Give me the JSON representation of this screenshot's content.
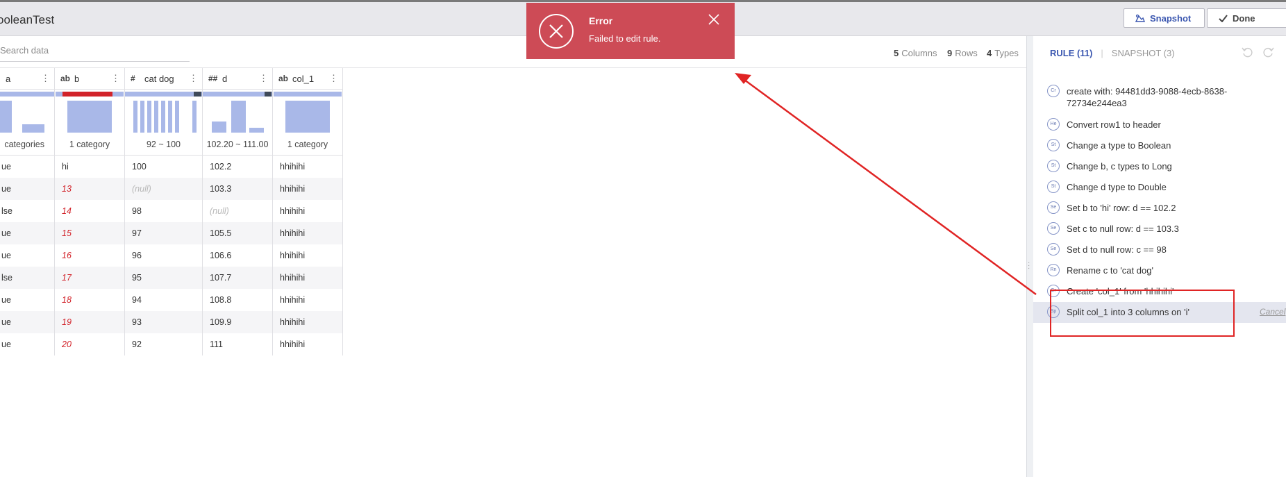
{
  "app": {
    "title": "ooleanTest",
    "snapshot_label": "Snapshot",
    "done_label": "Done"
  },
  "toast": {
    "title": "Error",
    "message": "Failed to edit rule."
  },
  "search": {
    "placeholder": "Search data"
  },
  "stats": {
    "columns_num": "5",
    "columns_label": "Columns",
    "rows_num": "9",
    "rows_label": "Rows",
    "types_num": "4",
    "types_label": "Types"
  },
  "grid": {
    "columns": [
      {
        "type": "",
        "name": "a",
        "summary": "categories"
      },
      {
        "type": "ab",
        "name": "b",
        "summary": "1 category"
      },
      {
        "type": "#",
        "name": "cat dog",
        "summary": "92 ~ 100"
      },
      {
        "type": "##",
        "name": "d",
        "summary": "102.20 ~ 111.00"
      },
      {
        "type": "ab",
        "name": "col_1",
        "summary": "1 category"
      }
    ],
    "rows": [
      [
        "ue",
        "hi",
        "100",
        "102.2",
        "hhihihi"
      ],
      [
        "ue",
        "13",
        "(null)",
        "103.3",
        "hhihihi"
      ],
      [
        "lse",
        "14",
        "98",
        "(null)",
        "hhihihi"
      ],
      [
        "ue",
        "15",
        "97",
        "105.5",
        "hhihihi"
      ],
      [
        "ue",
        "16",
        "96",
        "106.6",
        "hhihihi"
      ],
      [
        "lse",
        "17",
        "95",
        "107.7",
        "hhihihi"
      ],
      [
        "ue",
        "18",
        "94",
        "108.8",
        "hhihihi"
      ],
      [
        "ue",
        "19",
        "93",
        "109.9",
        "hhihihi"
      ],
      [
        "ue",
        "20",
        "92",
        "111",
        "hhihihi"
      ]
    ]
  },
  "panel": {
    "rule_tab": "RULE (11)",
    "snapshot_tab": "SNAPSHOT (3)",
    "rules": [
      {
        "badge": "Cr",
        "text": "create with: 94481dd3-9088-4ecb-8638-72734e244ea3"
      },
      {
        "badge": "He",
        "text": "Convert row1 to header"
      },
      {
        "badge": "St",
        "text": "Change a type to Boolean"
      },
      {
        "badge": "St",
        "text": "Change b, c types to Long"
      },
      {
        "badge": "St",
        "text": "Change d type to Double"
      },
      {
        "badge": "Se",
        "text": "Set b to 'hi' row: d == 102.2"
      },
      {
        "badge": "Se",
        "text": "Set c to null row: d == 103.3"
      },
      {
        "badge": "Se",
        "text": "Set d to null row: c == 98"
      },
      {
        "badge": "Rn",
        "text": "Rename c to 'cat dog'"
      },
      {
        "badge": "Cr",
        "text": "Create 'col_1' from 'hhihihi'"
      },
      {
        "badge": "Sp",
        "text": "Split col_1 into 3 columns on 'i'"
      }
    ],
    "cancel_label": "Cancel"
  },
  "colors": {
    "accent": "#3b57b0",
    "error": "#cd4b56",
    "annotation": "#e02424",
    "histogram": "#a9b8e8"
  }
}
